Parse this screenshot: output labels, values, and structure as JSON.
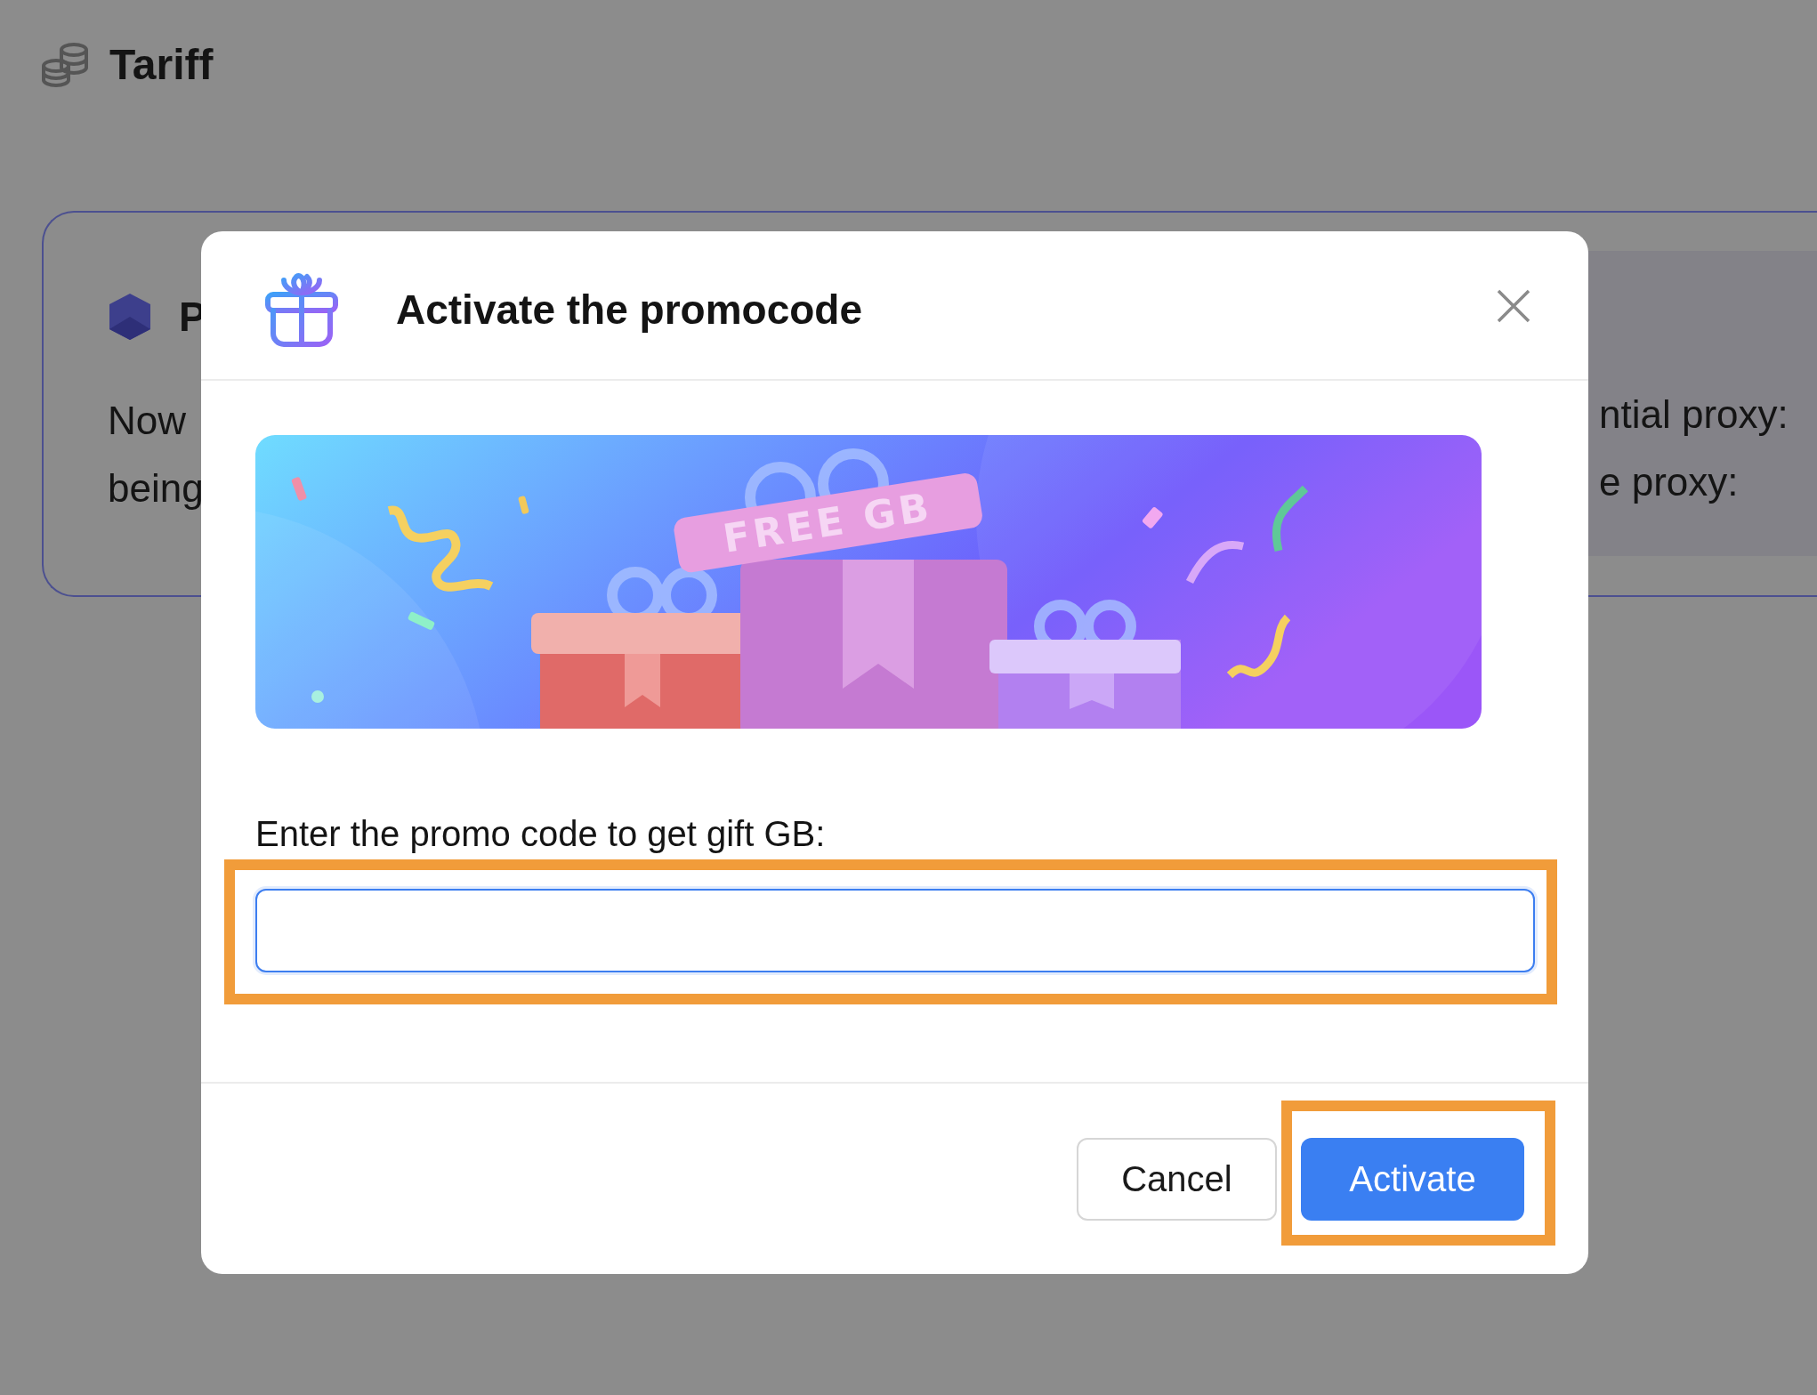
{
  "page": {
    "title": "Tariff"
  },
  "background_card": {
    "title": "P",
    "lines": [
      "Now",
      "being"
    ],
    "side_lines": [
      "ntial proxy:",
      "e proxy:"
    ]
  },
  "dialog": {
    "title": "Activate the promocode",
    "banner": {
      "text": "FREE GB"
    },
    "prompt": "Enter the promo code to get gift GB:",
    "promo_field": {
      "focused": true,
      "highlighted": true
    },
    "buttons": [
      {
        "label": "Cancel",
        "kind": "secondary",
        "highlighted": false
      },
      {
        "label": "Activate",
        "kind": "primary",
        "highlighted": true
      }
    ]
  }
}
